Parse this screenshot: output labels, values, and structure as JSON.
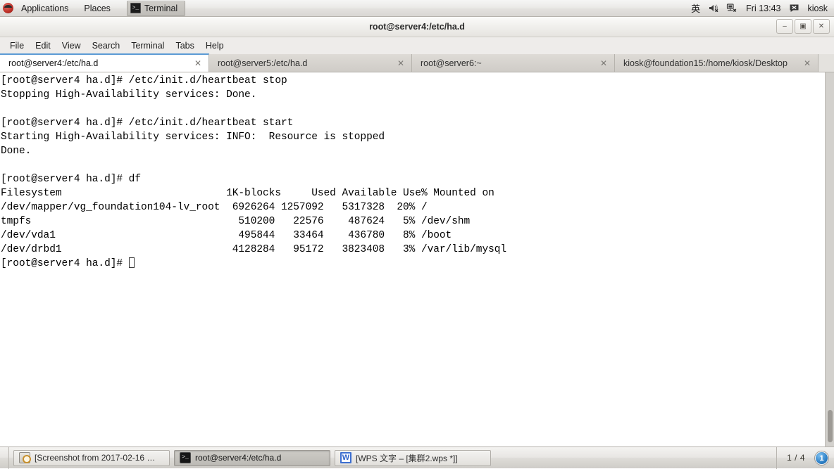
{
  "top_panel": {
    "logo_name": "redhat-logo-icon",
    "menus": [
      {
        "label": "Applications",
        "name": "applications-menu"
      },
      {
        "label": "Places",
        "name": "places-menu"
      }
    ],
    "window_list": [
      {
        "label": "Terminal",
        "icon": "terminal-icon",
        "name": "window-list-item-terminal"
      }
    ],
    "tray": {
      "input_method": "英",
      "volume_icon": "volume-muted-icon",
      "network_icon": "network-disconnected-icon",
      "clock": "Fri 13:43",
      "message_icon": "message-indicator-icon",
      "user": "kiosk"
    }
  },
  "window": {
    "title": "root@server4:/etc/ha.d",
    "controls": {
      "minimize": "–",
      "maximize": "▣",
      "close": "✕"
    },
    "menubar": [
      "File",
      "Edit",
      "View",
      "Search",
      "Terminal",
      "Tabs",
      "Help"
    ],
    "tabs": [
      {
        "label": "root@server4:/etc/ha.d",
        "active": true,
        "closable": true
      },
      {
        "label": "root@server5:/etc/ha.d",
        "active": false,
        "closable": true
      },
      {
        "label": "root@server6:~",
        "active": false,
        "closable": true
      },
      {
        "label": "kiosk@foundation15:/home/kiosk/Desktop",
        "active": false,
        "closable": true
      }
    ],
    "close_glyph": "✕"
  },
  "terminal": {
    "prompt": "[root@server4 ha.d]#",
    "lines": [
      "[root@server4 ha.d]# /etc/init.d/heartbeat stop",
      "Stopping High-Availability services: Done.",
      "",
      "[root@server4 ha.d]# /etc/init.d/heartbeat start",
      "Starting High-Availability services: INFO:  Resource is stopped",
      "Done.",
      "",
      "[root@server4 ha.d]# df",
      "Filesystem                           1K-blocks     Used Available Use% Mounted on",
      "/dev/mapper/vg_foundation104-lv_root  6926264 1257092   5317328  20% /",
      "tmpfs                                  510200   22576    487624   5% /dev/shm",
      "/dev/vda1                              495844   33464    436780   8% /boot",
      "/dev/drbd1                            4128284   95172   3823408   3% /var/lib/mysql"
    ],
    "last_prompt": "[root@server4 ha.d]# ",
    "df_table": {
      "headers": [
        "Filesystem",
        "1K-blocks",
        "Used",
        "Available",
        "Use%",
        "Mounted on"
      ],
      "rows": [
        [
          "/dev/mapper/vg_foundation104-lv_root",
          "6926264",
          "1257092",
          "5317328",
          "20%",
          "/"
        ],
        [
          "tmpfs",
          "510200",
          "22576",
          "487624",
          "5%",
          "/dev/shm"
        ],
        [
          "/dev/vda1",
          "495844",
          "33464",
          "436780",
          "8%",
          "/boot"
        ],
        [
          "/dev/drbd1",
          "4128284",
          "95172",
          "3823408",
          "3%",
          "/var/lib/mysql"
        ]
      ]
    }
  },
  "bottom_panel": {
    "tasks": [
      {
        "label": "[Screenshot from 2017-02-16 …",
        "icon": "image-viewer-icon",
        "active": false,
        "name": "taskbar-item-screenshot"
      },
      {
        "label": "root@server4:/etc/ha.d",
        "icon": "terminal-icon",
        "active": true,
        "name": "taskbar-item-terminal"
      },
      {
        "label": "[WPS 文字 – [集群2.wps *]]",
        "icon": "wps-icon",
        "active": false,
        "name": "taskbar-item-wps"
      }
    ],
    "task_icon_glyphs": {
      "terminal": ">_",
      "wps": "W"
    },
    "workspace_label": "1 / 4",
    "workspace_current": "1"
  }
}
